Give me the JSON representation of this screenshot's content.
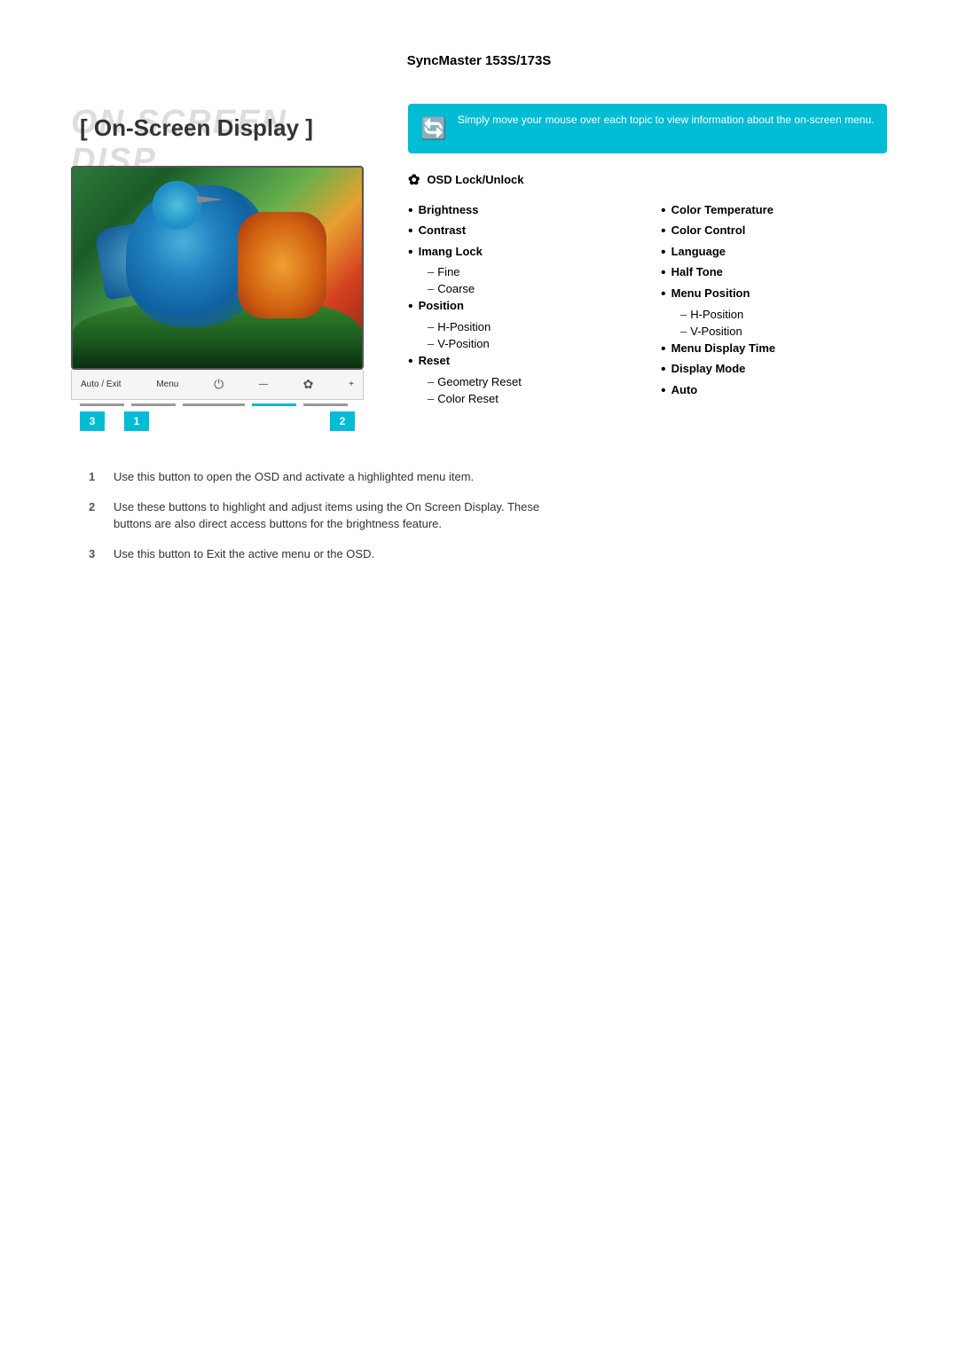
{
  "page": {
    "title": "SyncMaster 153S/173S"
  },
  "osd": {
    "bg_text": "ON SCREEN DISPLAY",
    "fg_text": "[ On-Screen Display ]"
  },
  "info_box": {
    "text": "Simply move your mouse over each topic to view information about the on-screen menu."
  },
  "osd_lock": {
    "label": "OSD Lock/Unlock"
  },
  "menu_left": {
    "items": [
      {
        "label": "Brightness",
        "bullet": true
      },
      {
        "label": "Contrast",
        "bullet": true
      },
      {
        "label": "Imang Lock",
        "bullet": true
      },
      {
        "sub": "Fine"
      },
      {
        "sub": "Coarse"
      },
      {
        "label": "Position",
        "bullet": true
      },
      {
        "sub": "H-Position"
      },
      {
        "sub": "V-Position"
      },
      {
        "label": "Reset",
        "bullet": true
      },
      {
        "sub": "Geometry Reset"
      },
      {
        "sub": "Color Reset"
      }
    ]
  },
  "menu_right": {
    "items": [
      {
        "label": "Color Temperature",
        "bullet": true
      },
      {
        "label": "Color Control",
        "bullet": true
      },
      {
        "label": "Language",
        "bullet": true
      },
      {
        "label": "Half Tone",
        "bullet": true
      },
      {
        "label": "Menu Position",
        "bullet": true
      },
      {
        "sub": "H-Position"
      },
      {
        "sub": "V-Position"
      },
      {
        "label": "Menu Display Time",
        "bullet": true
      },
      {
        "label": "Display Mode",
        "bullet": true
      },
      {
        "label": "Auto",
        "bullet": true
      }
    ]
  },
  "controls": {
    "labels": [
      "Auto / Exit",
      "Menu",
      "",
      "—",
      "✿",
      "+"
    ],
    "btn1": "1",
    "btn2": "2",
    "btn3": "3"
  },
  "instructions": [
    {
      "num": "1",
      "text": "Use this button to open the OSD and activate a highlighted menu item."
    },
    {
      "num": "2",
      "text": "Use these buttons to highlight and adjust items using the On Screen Display. These buttons are also direct access buttons for the brightness feature."
    },
    {
      "num": "3",
      "text": "Use this button to Exit the active menu or the OSD."
    }
  ]
}
